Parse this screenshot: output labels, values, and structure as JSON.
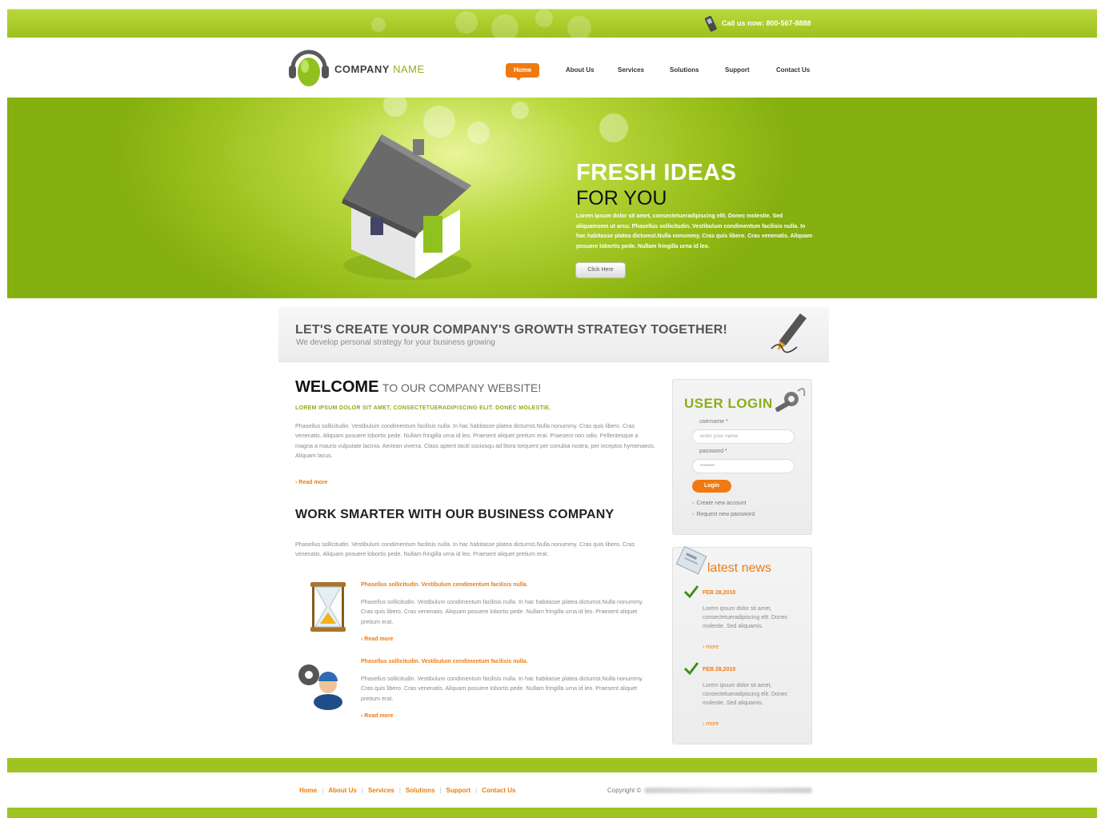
{
  "header": {
    "call_text": "Call us now: 800-567-8888",
    "logo_company": "COMPANY",
    "logo_name": "NAME",
    "nav": [
      "Home",
      "About Us",
      "Services",
      "Solutions",
      "Support",
      "Contact Us"
    ]
  },
  "hero": {
    "title": "FRESH IDEAS",
    "subtitle": "FOR YOU",
    "text": "Lorem ipsum dolor sit amet, consectetueradipiscing elit. Donec molestie. Sed aliquamsem ut arcu. Phasellus sollicitudin. Vestibulum condimentum facilisis nulla. In hac habitasse platea dictumst.Nulla nonummy. Cras quis libero. Cras venenatis. Aliquam posuere lobortis pede. Nullam fringilla urna id leo.",
    "button": "Click Here"
  },
  "banner": {
    "title": "LET'S CREATE YOUR COMPANY'S GROWTH STRATEGY TOGETHER!",
    "subtitle": "We develop personal strategy for your business growing"
  },
  "welcome": {
    "title_bold": "WELCOME",
    "title_rest": "TO OUR COMPANY WEBSITE!",
    "tagline": "LOREM IPSUM DOLOR SIT AMET, CONSECTETUERADIPISCING ELIT. DONEC MOLESTIE.",
    "text": "Phasellus sollicitudin. Vestibulum condimentum facilisis nulla. In hac habitasse platea dictumst.Nulla nonummy. Cras quis libero. Cras venenatis. Aliquam posuere lobortis pede. Nullam fringilla urna id leo. Praesent aliquet pretium erat. Praesent non odio. Pellentesque a magna a mauris vulputate lacinia. Aenean viverra. Class aptent taciti sociosqu ad litora torquent per conubia nostra, per inceptos hymenaeos. Aliquam lacus.",
    "read_more": "› Read more"
  },
  "work": {
    "title": "WORK SMARTER WITH OUR BUSINESS COMPANY",
    "text": "Phasellus sollicitudin. Vestibulum condimentum facilisis nulla. In hac habitasse platea dictumst.Nulla nonummy. Cras quis libero. Cras venenatis. Aliquam posuere lobortis pede. Nullam fringilla urna id leo. Praesent aliquet pretium erat.",
    "features": [
      {
        "icon": "hourglass-icon",
        "title": "Phasellus sollicitudin. Vestibulum condimentum facilisis nulla.",
        "text": "Phasellus sollicitudin. Vestibulum condimentum facilisis nulla. In hac habitasse platea dictumst.Nulla nonummy. Cras quis libero. Cras venenatis. Aliquam posuere lobortis pede. Nullam fringilla urna id leo. Praesent aliquet pretium erat.",
        "read_more": "› Read more"
      },
      {
        "icon": "worker-gear-icon",
        "title": "Phasellus sollicitudin. Vestibulum condimentum facilisis nulla.",
        "text": "Phasellus sollicitudin. Vestibulum condimentum facilisis nulla. In hac habitasse platea dictumst.Nulla nonummy. Cras quis libero. Cras venenatis. Aliquam posuere lobortis pede. Nullam fringilla urna id leo. Praesent aliquet pretium erat.",
        "read_more": "› Read more"
      }
    ]
  },
  "login": {
    "title": "USER LOGIN",
    "username_label": "username",
    "username_placeholder": "enter your name",
    "password_label": "password",
    "password_value": "••••••••",
    "required_mark": "*",
    "button": "Login",
    "links": [
      "Create new account",
      "Request new password"
    ]
  },
  "news": {
    "title": "latest news",
    "items": [
      {
        "date": "FEB 28,2010",
        "text": "Lorem ipsum dolor sit amet, consectetueradipiscing elit. Donec molestie. Sed aliquamis.",
        "more": "› more"
      },
      {
        "date": "FEB 28,2010",
        "text": "Lorem ipsum dolor sit amet, consectetueradipiscing elit. Donec molestie. Sed aliquamis.",
        "more": "› more"
      }
    ]
  },
  "footer": {
    "nav": [
      "Home",
      "About Us",
      "Services",
      "Solutions",
      "Support",
      "Contact Us"
    ],
    "copyright": "Copyright ©"
  },
  "colors": {
    "brand_green": "#9cc21f",
    "accent_orange": "#f07a10",
    "text_gray": "#8a8a8a"
  }
}
